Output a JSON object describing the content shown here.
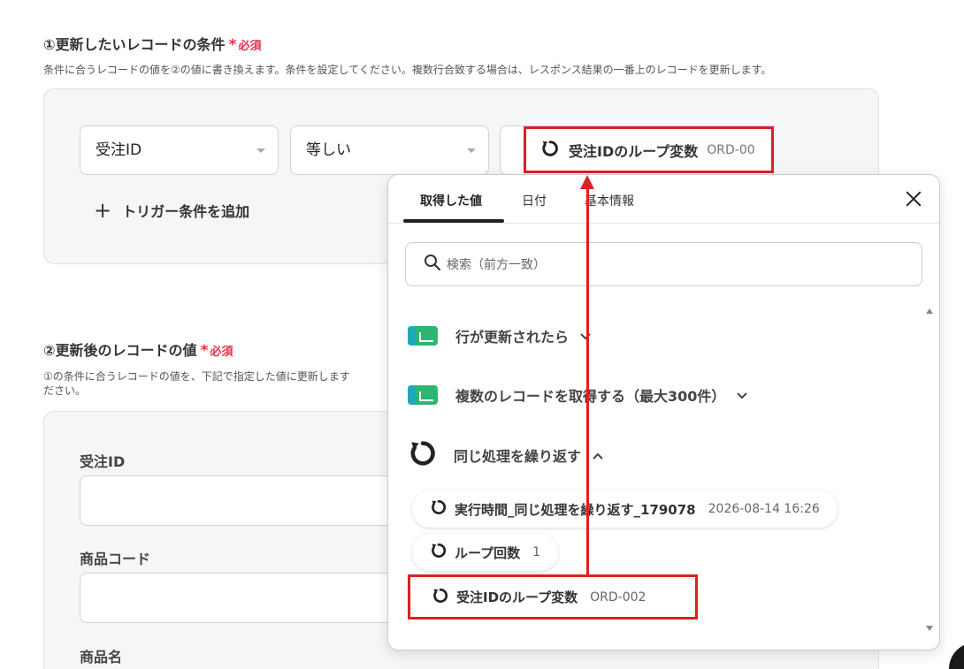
{
  "section1": {
    "title": "①更新したいレコードの条件",
    "required_star": "*",
    "required_label": "必須",
    "description": "条件に合うレコードの値を②の値に書き換えます。条件を設定してください。複数行合致する場合は、レスポンス結果の一番上のレコードを更新します。"
  },
  "condition": {
    "field_select": "受注ID",
    "operator_select": "等しい",
    "value_chip_label": "受注IDのループ変数",
    "value_chip_value": "ORD-00",
    "add_trigger": "トリガー条件を追加"
  },
  "section2": {
    "title": "②更新後のレコードの値",
    "required_star": "*",
    "required_label": "必須",
    "description_line1": "①の条件に合うレコードの値を、下記で指定した値に更新します",
    "description_line2": "ださい。",
    "fields": [
      {
        "label": "受注ID"
      },
      {
        "label": "商品コード"
      },
      {
        "label": "商品名"
      }
    ]
  },
  "popup": {
    "tabs": [
      "取得した値",
      "日付",
      "基本情報"
    ],
    "search_placeholder": "検索（前方一致）",
    "groups": [
      {
        "title": "行が更新されたら",
        "icon": "spreadsheet-icon",
        "expanded": false
      },
      {
        "title": "複数のレコードを取得する（最大300件）",
        "icon": "spreadsheet-icon",
        "expanded": false
      },
      {
        "title": "同じ処理を繰り返す",
        "icon": "loop-icon",
        "expanded": true
      }
    ],
    "items": [
      {
        "label": "実行時間_同じ処理を繰り返す_179078",
        "value": "2026-08-14 16:26"
      },
      {
        "label": "ループ回数",
        "value": "1"
      },
      {
        "label": "受注IDのループ変数",
        "value": "ORD-002"
      }
    ]
  },
  "colors": {
    "accent_red": "#e01e25",
    "required_red": "#e5304a",
    "sheet_green": "#2bb673"
  }
}
